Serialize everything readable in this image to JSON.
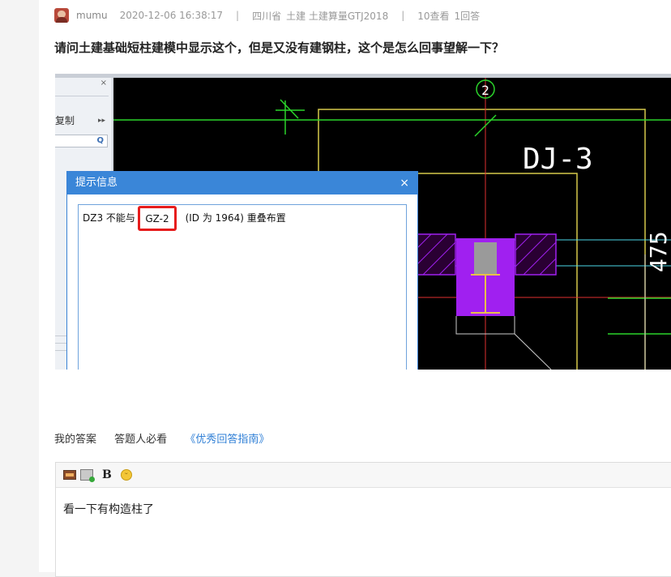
{
  "meta": {
    "username": "mumu",
    "datetime": "2020-12-06 16:38:17",
    "separator": "|",
    "region": "四川省",
    "category": "土建 土建算量GTJ2018",
    "views": "10查看",
    "answers": "1回答"
  },
  "question": {
    "title": "请问土建基础短柱建模中显示这个，但是又没有建钢柱，这个是怎么回事望解一下？"
  },
  "screenshot": {
    "left_panel": {
      "close": "×",
      "copy_label": "复制",
      "expand_arrow": "▸▸",
      "search_icon": "search-icon"
    },
    "cad": {
      "axis_label": "2",
      "element_label": "DJ-3",
      "dimension_text": "475"
    },
    "dialog": {
      "title": "提示信息",
      "close": "×",
      "message_prefix": "DZ3 不能与",
      "message_highlight": "GZ-2",
      "message_suffix": "(ID 为 1964) 重叠布置"
    },
    "colors": {
      "dialog_header": "#3a86d8",
      "highlight_border": "#e61c1c",
      "cad_background": "#000000",
      "cad_magenta": "#a020f0",
      "cad_yellow": "#d6c94b",
      "cad_green": "#2bd42b"
    }
  },
  "answer_tabs": {
    "my_answer": "我的答案",
    "must_read": "答题人必看",
    "guide": "《优秀回答指南》"
  },
  "editor": {
    "toolbar": {
      "image_icon": "image-icon",
      "upload_image_icon": "upload-image-icon",
      "bold": "B",
      "emoji_icon": "emoji-icon"
    },
    "content": "看一下有构造柱了"
  }
}
